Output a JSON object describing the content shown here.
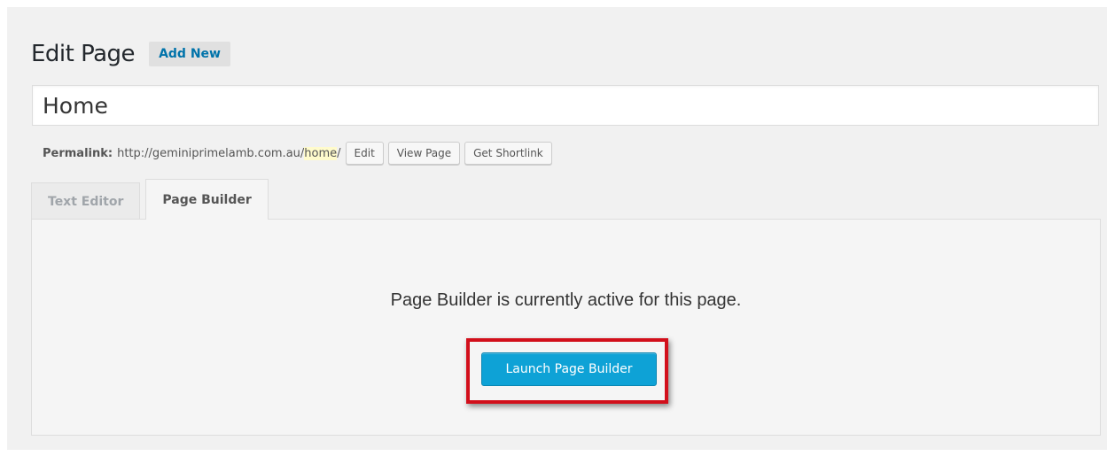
{
  "header": {
    "title": "Edit Page",
    "add_new_label": "Add New"
  },
  "title_field": {
    "value": "Home"
  },
  "permalink": {
    "label": "Permalink:",
    "url_base": "http://geminiprimelamb.com.au/",
    "slug": "home",
    "trailing": "/",
    "edit_label": "Edit",
    "view_label": "View Page",
    "shortlink_label": "Get Shortlink"
  },
  "tabs": [
    {
      "label": "Text Editor",
      "active": false
    },
    {
      "label": "Page Builder",
      "active": true
    }
  ],
  "builder": {
    "message": "Page Builder is currently active for this page.",
    "launch_label": "Launch Page Builder"
  },
  "colors": {
    "link_blue": "#0073aa",
    "primary_button": "#0ea2d6",
    "highlight_red": "#d20f1b",
    "slug_highlight": "#fffbcc"
  }
}
